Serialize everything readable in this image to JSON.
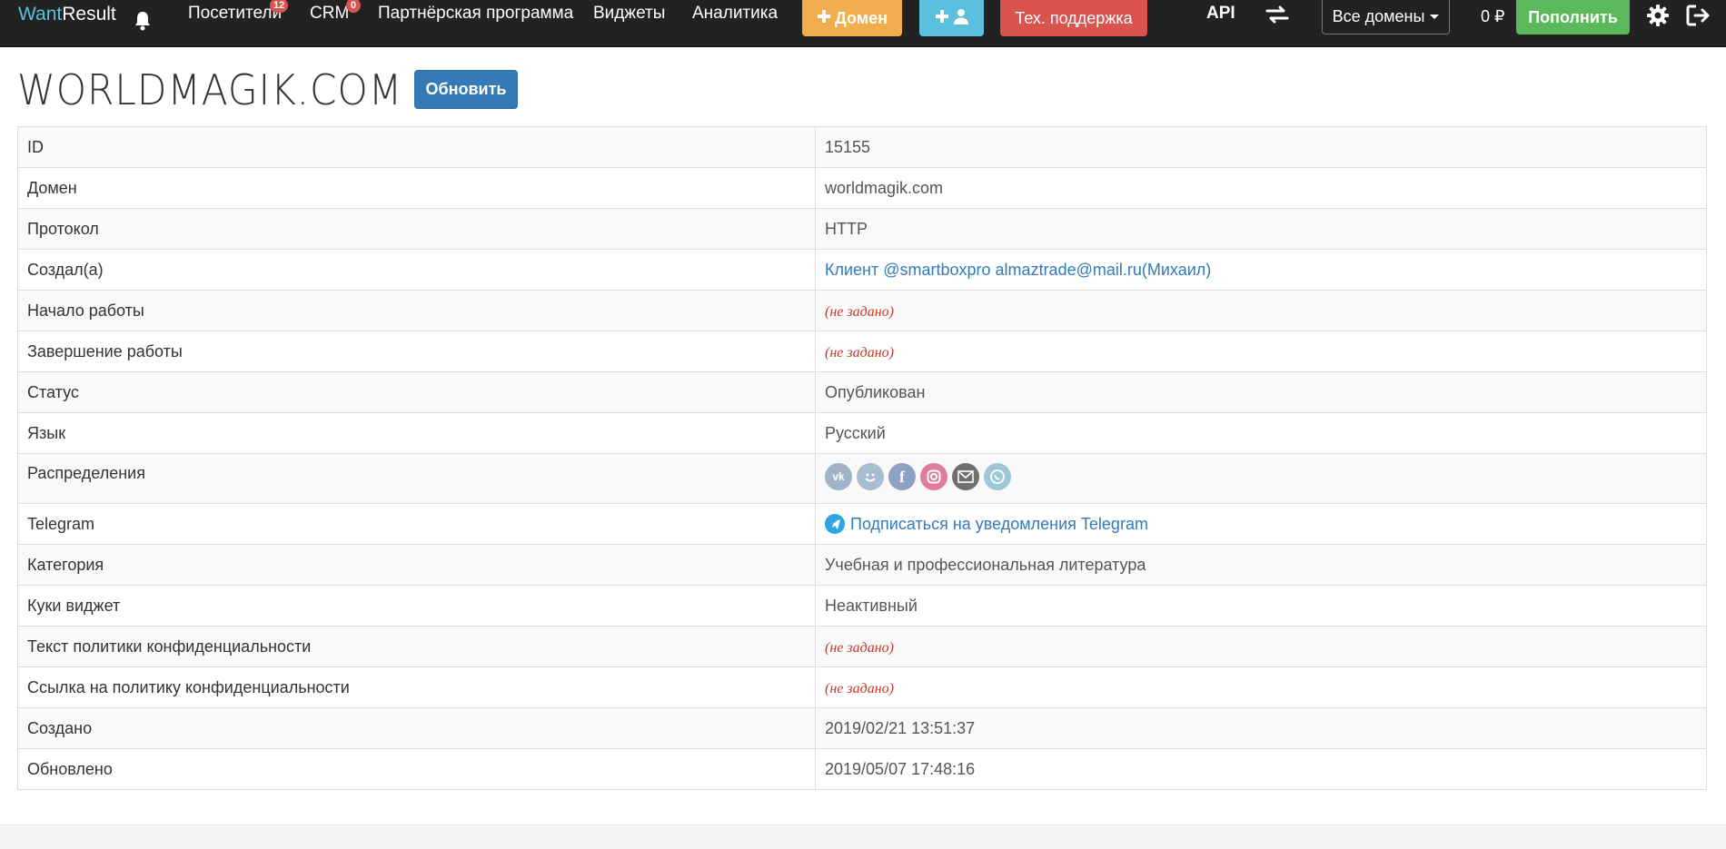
{
  "navbar": {
    "brand_want": "Want",
    "brand_result": "Result",
    "visitors": "Посетители",
    "visitors_badge": "12",
    "crm": "CRM",
    "crm_badge": "0",
    "partner": "Партнёрская программа",
    "widgets": "Виджеты",
    "analytics": "Аналитика",
    "add_domain": "Домен",
    "support": "Тех. поддержка",
    "api": "API",
    "domains_select": "Все домены",
    "balance": "0 ₽",
    "topup": "Пополнить"
  },
  "page": {
    "title": "WORLDMAGIK.COM",
    "refresh": "Обновить"
  },
  "details": {
    "id": {
      "label": "ID",
      "value": "15155"
    },
    "domain": {
      "label": "Домен",
      "value": "worldmagik.com"
    },
    "protocol": {
      "label": "Протокол",
      "value": "HTTP"
    },
    "creator": {
      "label": "Создал(а)",
      "value": "Клиент @smartboxpro almaztrade@mail.ru(Михаил)"
    },
    "start": {
      "label": "Начало работы",
      "value": "(не задано)"
    },
    "end": {
      "label": "Завершение работы",
      "value": "(не задано)"
    },
    "status": {
      "label": "Статус",
      "value": "Опубликован"
    },
    "language": {
      "label": "Язык",
      "value": "Русский"
    },
    "distribution": {
      "label": "Распределения",
      "icons": [
        "vk-icon",
        "smile-icon",
        "facebook-icon",
        "instagram-icon",
        "email-icon",
        "whatsapp-icon"
      ]
    },
    "telegram": {
      "label": "Telegram",
      "value": "Подписаться на уведомления Telegram"
    },
    "category": {
      "label": "Категория",
      "value": "Учебная и профессиональная литература"
    },
    "cookie": {
      "label": "Куки виджет",
      "value": "Неактивный"
    },
    "privacy_text": {
      "label": "Текст политики конфиденциальности",
      "value": "(не задано)"
    },
    "privacy_link": {
      "label": "Ссылка на политику конфиденциальности",
      "value": "(не задано)"
    },
    "created": {
      "label": "Создано",
      "value": "2019/02/21 13:51:37"
    },
    "updated": {
      "label": "Обновлено",
      "value": "2019/05/07 17:48:16"
    }
  },
  "colors": {
    "navbar_bg": "#222222",
    "primary": "#337ab7",
    "warning": "#f0ad4e",
    "info": "#5bc0de",
    "danger": "#d9534f",
    "success": "#5cb85c"
  }
}
